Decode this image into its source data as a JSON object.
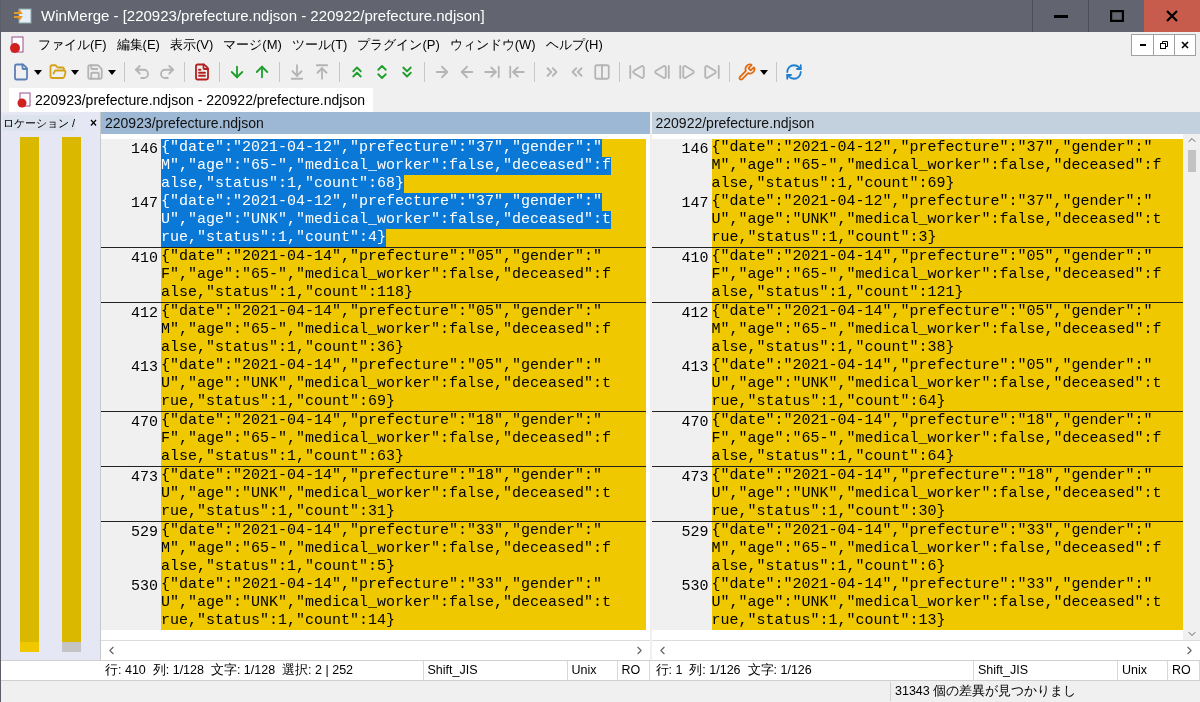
{
  "window": {
    "title": "WinMerge - [220923/prefecture.ndjson - 220922/prefecture.ndjson]"
  },
  "menu": [
    "ファイル(F)",
    "編集(E)",
    "表示(V)",
    "マージ(M)",
    "ツール(T)",
    "プラグイン(P)",
    "ウィンドウ(W)",
    "ヘルプ(H)"
  ],
  "toolbar": [
    {
      "kind": "new",
      "disabled": false,
      "dropdown": true
    },
    {
      "kind": "open",
      "disabled": false,
      "dropdown": true
    },
    {
      "kind": "save",
      "disabled": true,
      "dropdown": true
    },
    {
      "kind": "sep"
    },
    {
      "kind": "undo",
      "disabled": true,
      "dropdown": false
    },
    {
      "kind": "redo",
      "disabled": true,
      "dropdown": false
    },
    {
      "kind": "sep"
    },
    {
      "kind": "report",
      "disabled": false,
      "dropdown": false
    },
    {
      "kind": "sep"
    },
    {
      "kind": "copy-down",
      "disabled": false,
      "dropdown": false
    },
    {
      "kind": "copy-up",
      "disabled": false,
      "dropdown": false
    },
    {
      "kind": "sep"
    },
    {
      "kind": "all-down",
      "disabled": true,
      "dropdown": false
    },
    {
      "kind": "all-up",
      "disabled": true,
      "dropdown": false
    },
    {
      "kind": "sep"
    },
    {
      "kind": "first-diff",
      "disabled": false,
      "dropdown": false
    },
    {
      "kind": "current-diff",
      "disabled": false,
      "dropdown": false
    },
    {
      "kind": "last-diff",
      "disabled": false,
      "dropdown": false
    },
    {
      "kind": "sep"
    },
    {
      "kind": "copy-right",
      "disabled": true,
      "dropdown": false
    },
    {
      "kind": "copy-left",
      "disabled": true,
      "dropdown": false
    },
    {
      "kind": "copy-right-advance",
      "disabled": true,
      "dropdown": false
    },
    {
      "kind": "copy-left-advance",
      "disabled": true,
      "dropdown": false
    },
    {
      "kind": "sep"
    },
    {
      "kind": "all-right",
      "disabled": true,
      "dropdown": false
    },
    {
      "kind": "all-left",
      "disabled": true,
      "dropdown": false
    },
    {
      "kind": "compare",
      "disabled": true,
      "dropdown": false
    },
    {
      "kind": "sep"
    },
    {
      "kind": "first-left",
      "disabled": true,
      "dropdown": false
    },
    {
      "kind": "prev-left",
      "disabled": true,
      "dropdown": false
    },
    {
      "kind": "next-right",
      "disabled": true,
      "dropdown": false
    },
    {
      "kind": "last-right",
      "disabled": true,
      "dropdown": false
    },
    {
      "kind": "sep"
    },
    {
      "kind": "options",
      "disabled": false,
      "dropdown": true
    },
    {
      "kind": "sep"
    },
    {
      "kind": "refresh",
      "disabled": false,
      "dropdown": false
    }
  ],
  "document_tab": {
    "label": "220923/prefecture.ndjson - 220922/prefecture.ndjson",
    "selected": true
  },
  "location_pane": {
    "title": "ロケーション /",
    "close": "×"
  },
  "panes": [
    {
      "title": "220923/prefecture.ndjson",
      "active": true
    },
    {
      "title": "220922/prefecture.ndjson",
      "active": false
    }
  ],
  "diff_groups": [
    {
      "rows": [
        {
          "left": {
            "number": "146",
            "selected": true,
            "lines": [
              "{\"date\":\"2021-04-12\",\"prefecture\":\"37\",\"gender\":\"",
              "M\",\"age\":\"65-\",\"medical_worker\":false,\"deceased\":f",
              "alse,\"status\":1,\"count\":68}"
            ]
          },
          "right": {
            "number": "146",
            "selected": false,
            "lines": [
              "{\"date\":\"2021-04-12\",\"prefecture\":\"37\",\"gender\":\"",
              "M\",\"age\":\"65-\",\"medical_worker\":false,\"deceased\":f",
              "alse,\"status\":1,\"count\":69}"
            ]
          }
        },
        {
          "left": {
            "number": "147",
            "selected": true,
            "lines": [
              "{\"date\":\"2021-04-12\",\"prefecture\":\"37\",\"gender\":\"",
              "U\",\"age\":\"UNK\",\"medical_worker\":false,\"deceased\":t",
              "rue,\"status\":1,\"count\":4}"
            ]
          },
          "right": {
            "number": "147",
            "selected": false,
            "lines": [
              "{\"date\":\"2021-04-12\",\"prefecture\":\"37\",\"gender\":\"",
              "U\",\"age\":\"UNK\",\"medical_worker\":false,\"deceased\":t",
              "rue,\"status\":1,\"count\":3}"
            ]
          }
        }
      ]
    },
    {
      "rows": [
        {
          "left": {
            "number": "410",
            "selected": false,
            "lines": [
              "{\"date\":\"2021-04-14\",\"prefecture\":\"05\",\"gender\":\"",
              "F\",\"age\":\"65-\",\"medical_worker\":false,\"deceased\":f",
              "alse,\"status\":1,\"count\":118}"
            ]
          },
          "right": {
            "number": "410",
            "selected": false,
            "lines": [
              "{\"date\":\"2021-04-14\",\"prefecture\":\"05\",\"gender\":\"",
              "F\",\"age\":\"65-\",\"medical_worker\":false,\"deceased\":f",
              "alse,\"status\":1,\"count\":121}"
            ]
          }
        }
      ]
    },
    {
      "rows": [
        {
          "left": {
            "number": "412",
            "selected": false,
            "lines": [
              "{\"date\":\"2021-04-14\",\"prefecture\":\"05\",\"gender\":\"",
              "M\",\"age\":\"65-\",\"medical_worker\":false,\"deceased\":f",
              "alse,\"status\":1,\"count\":36}"
            ]
          },
          "right": {
            "number": "412",
            "selected": false,
            "lines": [
              "{\"date\":\"2021-04-14\",\"prefecture\":\"05\",\"gender\":\"",
              "M\",\"age\":\"65-\",\"medical_worker\":false,\"deceased\":f",
              "alse,\"status\":1,\"count\":38}"
            ]
          }
        },
        {
          "left": {
            "number": "413",
            "selected": false,
            "lines": [
              "{\"date\":\"2021-04-14\",\"prefecture\":\"05\",\"gender\":\"",
              "U\",\"age\":\"UNK\",\"medical_worker\":false,\"deceased\":t",
              "rue,\"status\":1,\"count\":69}"
            ]
          },
          "right": {
            "number": "413",
            "selected": false,
            "lines": [
              "{\"date\":\"2021-04-14\",\"prefecture\":\"05\",\"gender\":\"",
              "U\",\"age\":\"UNK\",\"medical_worker\":false,\"deceased\":t",
              "rue,\"status\":1,\"count\":64}"
            ]
          }
        }
      ]
    },
    {
      "rows": [
        {
          "left": {
            "number": "470",
            "selected": false,
            "lines": [
              "{\"date\":\"2021-04-14\",\"prefecture\":\"18\",\"gender\":\"",
              "F\",\"age\":\"65-\",\"medical_worker\":false,\"deceased\":f",
              "alse,\"status\":1,\"count\":63}"
            ]
          },
          "right": {
            "number": "470",
            "selected": false,
            "lines": [
              "{\"date\":\"2021-04-14\",\"prefecture\":\"18\",\"gender\":\"",
              "F\",\"age\":\"65-\",\"medical_worker\":false,\"deceased\":f",
              "alse,\"status\":1,\"count\":64}"
            ]
          }
        }
      ]
    },
    {
      "rows": [
        {
          "left": {
            "number": "473",
            "selected": false,
            "lines": [
              "{\"date\":\"2021-04-14\",\"prefecture\":\"18\",\"gender\":\"",
              "U\",\"age\":\"UNK\",\"medical_worker\":false,\"deceased\":t",
              "rue,\"status\":1,\"count\":31}"
            ]
          },
          "right": {
            "number": "473",
            "selected": false,
            "lines": [
              "{\"date\":\"2021-04-14\",\"prefecture\":\"18\",\"gender\":\"",
              "U\",\"age\":\"UNK\",\"medical_worker\":false,\"deceased\":t",
              "rue,\"status\":1,\"count\":30}"
            ]
          }
        }
      ]
    },
    {
      "rows": [
        {
          "left": {
            "number": "529",
            "selected": false,
            "lines": [
              "{\"date\":\"2021-04-14\",\"prefecture\":\"33\",\"gender\":\"",
              "M\",\"age\":\"65-\",\"medical_worker\":false,\"deceased\":f",
              "alse,\"status\":1,\"count\":5}"
            ]
          },
          "right": {
            "number": "529",
            "selected": false,
            "lines": [
              "{\"date\":\"2021-04-14\",\"prefecture\":\"33\",\"gender\":\"",
              "M\",\"age\":\"65-\",\"medical_worker\":false,\"deceased\":f",
              "alse,\"status\":1,\"count\":6}"
            ]
          }
        },
        {
          "left": {
            "number": "530",
            "selected": false,
            "lines": [
              "{\"date\":\"2021-04-14\",\"prefecture\":\"33\",\"gender\":\"",
              "U\",\"age\":\"UNK\",\"medical_worker\":false,\"deceased\":t",
              "rue,\"status\":1,\"count\":14}"
            ]
          },
          "right": {
            "number": "530",
            "selected": false,
            "lines": [
              "{\"date\":\"2021-04-14\",\"prefecture\":\"33\",\"gender\":\"",
              "U\",\"age\":\"UNK\",\"medical_worker\":false,\"deceased\":t",
              "rue,\"status\":1,\"count\":13}"
            ]
          }
        }
      ]
    }
  ],
  "status_bars": [
    {
      "position": "行: 410  列: 1/128  文字: 1/128  選択: 2 | 252",
      "encoding": "Shift_JIS",
      "eol": "Unix",
      "mode": "RO"
    },
    {
      "position": "行: 1  列: 1/126  文字: 1/126",
      "encoding": "Shift_JIS",
      "eol": "Unix",
      "mode": "RO"
    }
  ],
  "message": "31343 個の差異が見つかりまし"
}
